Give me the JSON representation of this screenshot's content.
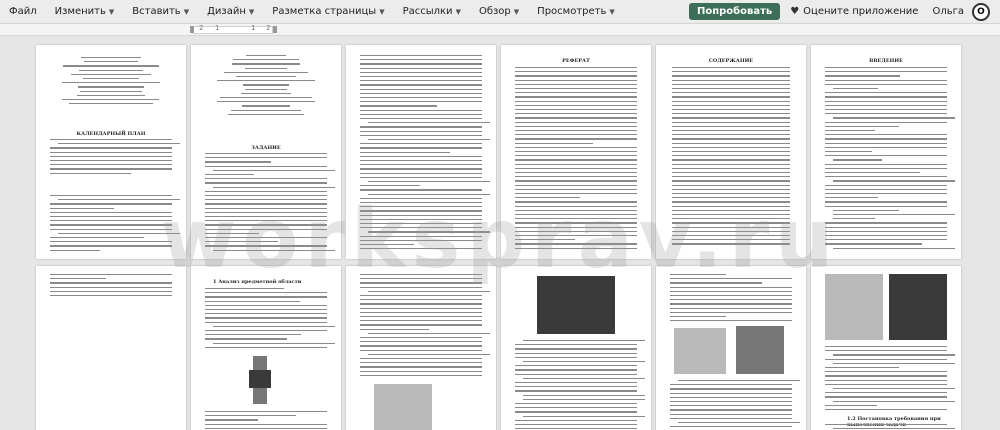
{
  "menubar": {
    "items": [
      {
        "label": "Файл",
        "caret": false
      },
      {
        "label": "Изменить",
        "caret": true
      },
      {
        "label": "Вставить",
        "caret": true
      },
      {
        "label": "Дизайн",
        "caret": true
      },
      {
        "label": "Разметка страницы",
        "caret": true
      },
      {
        "label": "Рассылки",
        "caret": true
      },
      {
        "label": "Обзор",
        "caret": true
      },
      {
        "label": "Просмотреть",
        "caret": true
      }
    ],
    "try_button": "Попробовать",
    "rate_label": "Оцените приложение",
    "user_name": "Ольга",
    "avatar_letter": "О"
  },
  "ruler": {
    "numbers": [
      "2",
      "1",
      "1",
      "2"
    ]
  },
  "watermark": "worksprav.ru",
  "pages": {
    "p1_title": "КАЛЕНДАРНЫЙ ПЛАН",
    "p2_title": "ЗАДАНИЕ",
    "p4_title": "РЕФЕРАТ",
    "p5_title": "СОДЕРЖАНИЕ",
    "p6_title": "ВВЕДЕНИЕ",
    "p8_heading": "1 Анализ предметной области",
    "p12_heading": "1.2 Постановка требования при выполнении задачи"
  }
}
